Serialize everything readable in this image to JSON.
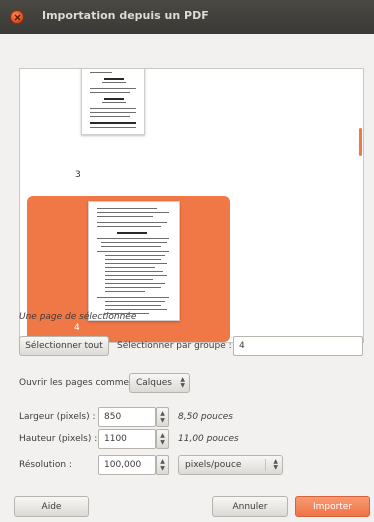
{
  "window": {
    "title": "Importation depuis un PDF"
  },
  "preview": {
    "pages": [
      {
        "label": "3",
        "selected": false
      },
      {
        "label": "4",
        "selected": true
      }
    ],
    "accent": "#f07746"
  },
  "status": "Une page de sélectionnée",
  "selection": {
    "select_all_label": "Sélectionner tout",
    "group_label": "Sélectionner par groupe :",
    "group_value": "4"
  },
  "open_as": {
    "label": "Ouvrir les pages comme",
    "value": "Calques"
  },
  "dimensions": {
    "width_label": "Largeur (pixels) :",
    "width_value": "850",
    "width_hint": "8,50 pouces",
    "height_label": "Hauteur (pixels) :",
    "height_value": "1100",
    "height_hint": "11,00 pouces",
    "resolution_label": "Résolution :",
    "resolution_value": "100,000",
    "resolution_unit": "pixels/pouce"
  },
  "buttons": {
    "help": "Aide",
    "cancel": "Annuler",
    "import": "Importer"
  }
}
